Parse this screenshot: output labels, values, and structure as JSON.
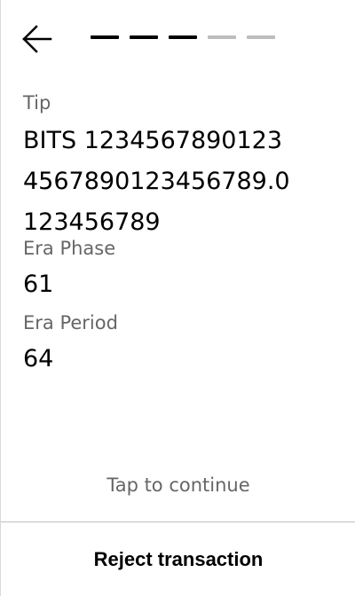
{
  "header": {
    "back_icon": "arrow-left-icon",
    "progress": {
      "steps": [
        {
          "state": "complete",
          "color": "#000000"
        },
        {
          "state": "complete",
          "color": "#000000"
        },
        {
          "state": "complete",
          "color": "#000000"
        },
        {
          "state": "pending",
          "color": "#bdbdbd"
        },
        {
          "state": "pending",
          "color": "#bdbdbd"
        }
      ]
    }
  },
  "fields": {
    "tip": {
      "label": "Tip",
      "value": "BITS 1234567890123 4567890123456789.0 123456789"
    },
    "era_phase": {
      "label": "Era Phase",
      "value": "61"
    },
    "era_period": {
      "label": "Era Period",
      "value": "64"
    }
  },
  "footer": {
    "tap_to_continue": "Tap to continue",
    "reject_label": "Reject transaction"
  }
}
